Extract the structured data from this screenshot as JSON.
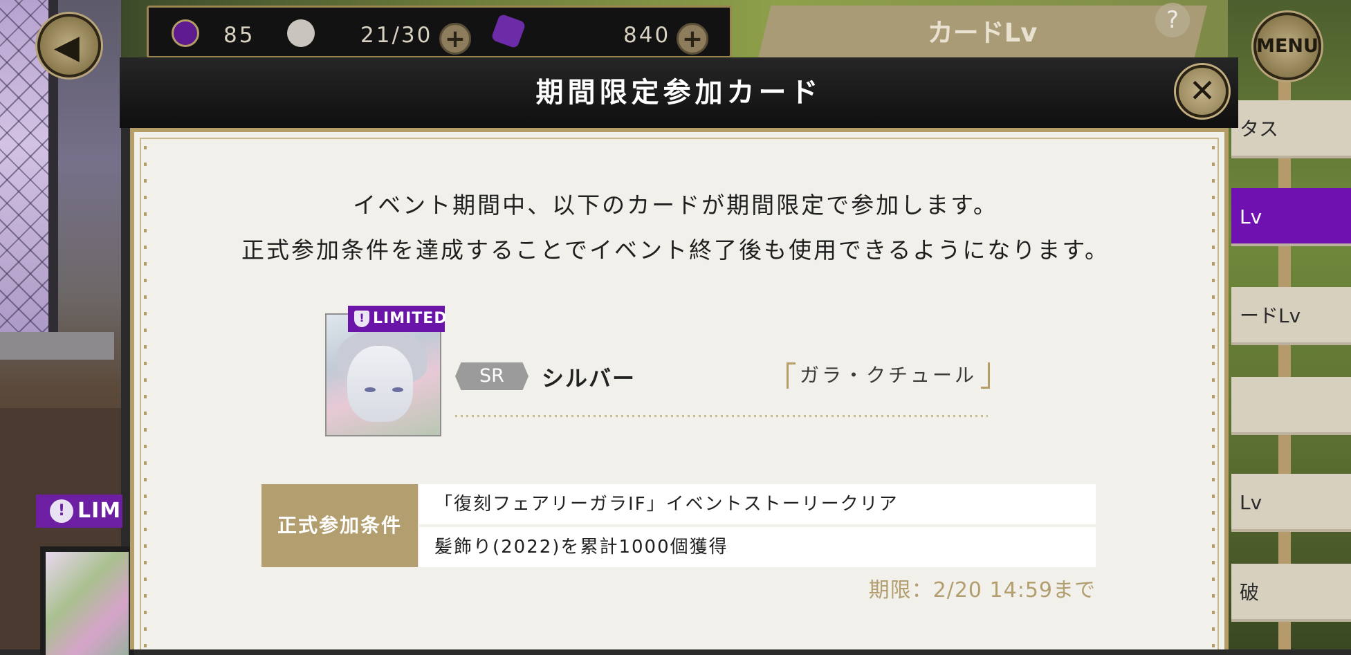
{
  "hud": {
    "currency_1": "85",
    "stamina": "21/30",
    "gems": "840",
    "plus_symbol": "+",
    "back_symbol": "◀"
  },
  "menu": {
    "label": "MENU"
  },
  "top_tab": {
    "label": "カードLv",
    "help": "?"
  },
  "side": {
    "limited_label": "LIM",
    "tabs": [
      "タス",
      "Lv",
      "ードLv",
      "",
      "Lv",
      "破"
    ]
  },
  "dialog": {
    "title": "期間限定参加カード",
    "close_symbol": "✕",
    "intro_line_1": "イベント期間中、以下のカードが期間限定で参加します。",
    "intro_line_2": "正式参加条件を達成することでイベント終了後も使用できるようになります。",
    "card": {
      "limited_label": "LIMITED",
      "rarity": "SR",
      "name": "シルバー",
      "title": "ガラ・クチュール"
    },
    "conditions_label": "正式参加条件",
    "conditions": [
      "「復刻フェアリーガラIF」イベントストーリークリア",
      "髪飾り(2022)を累計1000個獲得"
    ],
    "deadline": "期限：2/20 14:59まで"
  },
  "colors": {
    "gold": "#b29e6e",
    "purple": "#6a14aa",
    "panel": "#f2f0ea",
    "header": "#121212"
  }
}
